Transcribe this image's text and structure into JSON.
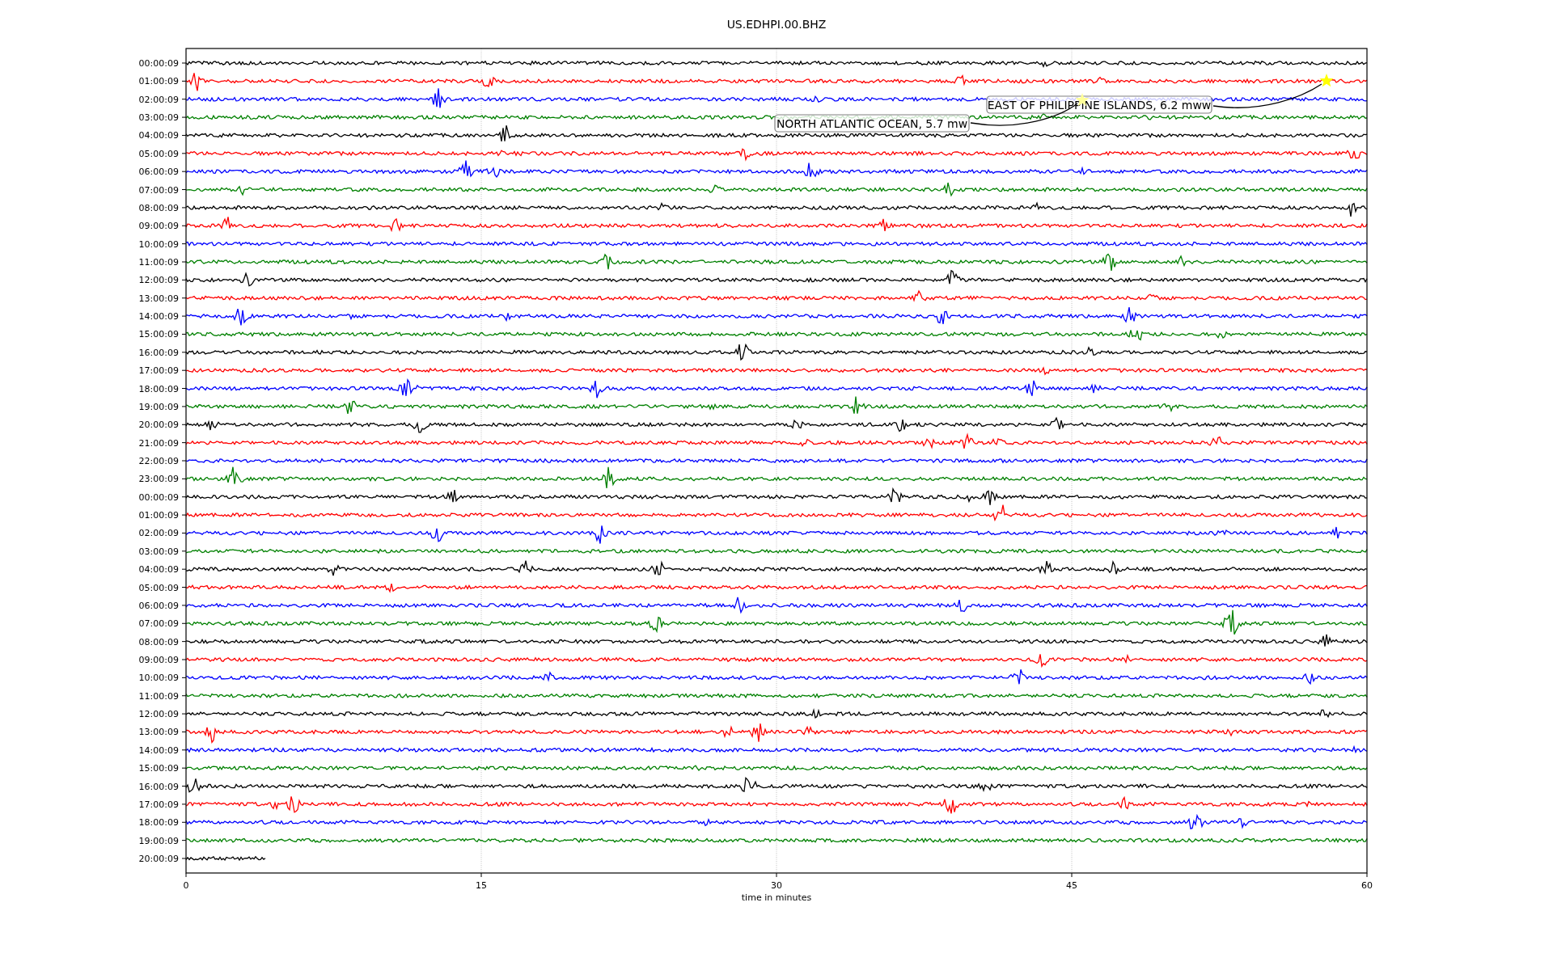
{
  "title": "US.EDHPI.00.BHZ",
  "rows": [
    {
      "label": "00:00:09",
      "color": "#000000",
      "level": 1
    },
    {
      "label": "01:00:09",
      "color": "#ff0000",
      "level": 1
    },
    {
      "label": "02:00:09",
      "color": "#0000ff",
      "level": 1
    },
    {
      "label": "03:00:09",
      "color": "#008000",
      "level": 1
    },
    {
      "label": "04:00:09",
      "color": "#000000",
      "level": 1
    },
    {
      "label": "05:00:09",
      "color": "#ff0000",
      "level": 1
    },
    {
      "label": "06:00:09",
      "color": "#0000ff",
      "level": 1
    },
    {
      "label": "07:00:09",
      "color": "#008000",
      "level": 1
    },
    {
      "label": "08:00:09",
      "color": "#000000",
      "level": 1
    },
    {
      "label": "09:00:09",
      "color": "#ff0000",
      "level": 1
    },
    {
      "label": "10:00:09",
      "color": "#0000ff",
      "level": 1
    },
    {
      "label": "11:00:09",
      "color": "#008000",
      "level": 1
    },
    {
      "label": "12:00:09",
      "color": "#000000",
      "level": 1
    },
    {
      "label": "13:00:09",
      "color": "#ff0000",
      "level": 1
    },
    {
      "label": "14:00:09",
      "color": "#0000ff",
      "level": 1
    },
    {
      "label": "15:00:09",
      "color": "#008000",
      "level": 1
    },
    {
      "label": "16:00:09",
      "color": "#000000",
      "level": 1
    },
    {
      "label": "17:00:09",
      "color": "#ff0000",
      "level": 1
    },
    {
      "label": "18:00:09",
      "color": "#0000ff",
      "level": 1
    },
    {
      "label": "19:00:09",
      "color": "#008000",
      "level": 1
    },
    {
      "label": "20:00:09",
      "color": "#000000",
      "level": 1
    },
    {
      "label": "21:00:09",
      "color": "#ff0000",
      "level": 1
    },
    {
      "label": "22:00:09",
      "color": "#0000ff",
      "level": 1
    },
    {
      "label": "23:00:09",
      "color": "#008000",
      "level": 1
    },
    {
      "label": "00:00:09",
      "color": "#000000",
      "level": 1
    },
    {
      "label": "01:00:09",
      "color": "#ff0000",
      "level": 1
    },
    {
      "label": "02:00:09",
      "color": "#0000ff",
      "level": 1
    },
    {
      "label": "03:00:09",
      "color": "#008000",
      "level": 1
    },
    {
      "label": "04:00:09",
      "color": "#000000",
      "level": 1
    },
    {
      "label": "05:00:09",
      "color": "#ff0000",
      "level": 1
    },
    {
      "label": "06:00:09",
      "color": "#0000ff",
      "level": 1
    },
    {
      "label": "07:00:09",
      "color": "#008000",
      "level": 1
    },
    {
      "label": "08:00:09",
      "color": "#000000",
      "level": 1
    },
    {
      "label": "09:00:09",
      "color": "#ff0000",
      "level": 1
    },
    {
      "label": "10:00:09",
      "color": "#0000ff",
      "level": 1
    },
    {
      "label": "11:00:09",
      "color": "#008000",
      "level": 1
    },
    {
      "label": "12:00:09",
      "color": "#000000",
      "level": 1
    },
    {
      "label": "13:00:09",
      "color": "#ff0000",
      "level": 1
    },
    {
      "label": "14:00:09",
      "color": "#0000ff",
      "level": 1
    },
    {
      "label": "15:00:09",
      "color": "#008000",
      "level": 1
    },
    {
      "label": "16:00:09",
      "color": "#000000",
      "level": 1
    },
    {
      "label": "17:00:09",
      "color": "#ff0000",
      "level": 1
    },
    {
      "label": "18:00:09",
      "color": "#0000ff",
      "level": 1
    },
    {
      "label": "19:00:09",
      "color": "#008000",
      "level": 1
    },
    {
      "label": "20:00:09",
      "color": "#000000",
      "level": 0.068
    }
  ],
  "xticks": [
    "0",
    "15",
    "30",
    "45",
    "60"
  ],
  "xlabel": "time in minutes",
  "annotations": [
    {
      "text": "EAST OF PHILIPPINE ISLANDS, 6.2 mww"
    },
    {
      "text": "NORTH ATLANTIC OCEAN, 5.7 mw"
    }
  ]
}
